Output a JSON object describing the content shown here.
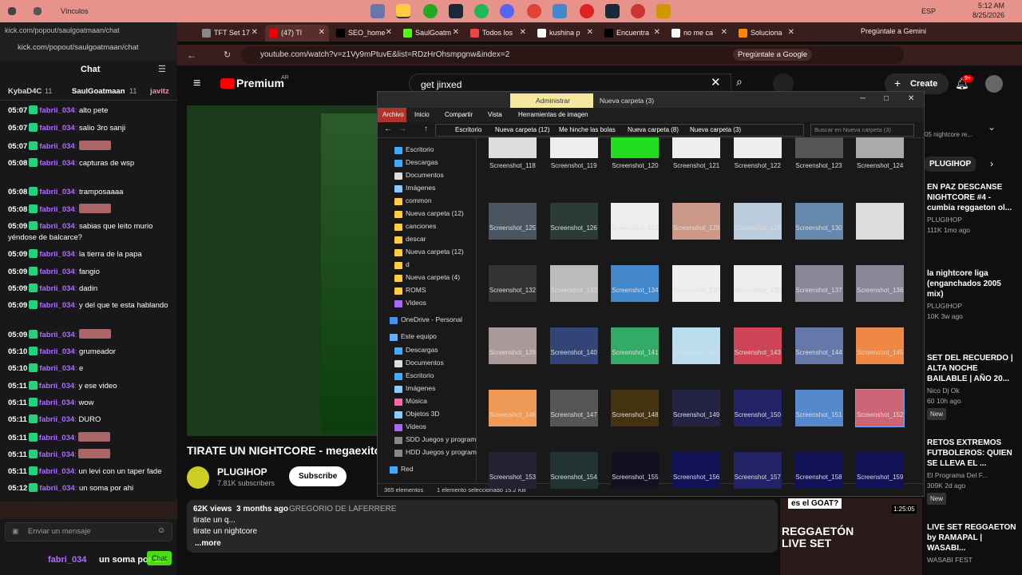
{
  "taskbar": {
    "vinculos": "Vínculos",
    "time": "5:12 AM",
    "date": "8/25/2026",
    "lang": "ESP"
  },
  "tabs": [
    {
      "label": "TFT Set 17",
      "color": "#888"
    },
    {
      "label": "(47) Tl",
      "color": "#e00"
    },
    {
      "label": "SEO_home",
      "color": "#000"
    },
    {
      "label": "SaulGoatm",
      "color": "#53fc18"
    },
    {
      "label": "Todos los",
      "color": "#e44"
    },
    {
      "label": "kushina p",
      "color": "#fff"
    },
    {
      "label": "Encuentra",
      "color": "#000"
    },
    {
      "label": "no me ca",
      "color": "#fff"
    },
    {
      "label": "Soluciona",
      "color": "#f80"
    }
  ],
  "kick": {
    "url": "kick.com/popout/saulgoatmaan/chat",
    "tab_title": "kick.com/popout/saulgoatmaan/chat",
    "chat_title": "Chat",
    "top_users": [
      "KybaD4C",
      "11",
      "SaulGoatmaan",
      "11",
      "javitz"
    ],
    "input_placeholder": "Enviar un mensaje",
    "send_label": "Chat",
    "bottom_user": "fabri_034",
    "bottom_text": "un soma por ahi"
  },
  "chat_messages": [
    {
      "time": "05:07",
      "user": "fabrii_034",
      "text": "alto pete"
    },
    {
      "time": "05:07",
      "user": "fabrii_034",
      "text": "salio 3ro sanji"
    },
    {
      "time": "05:07",
      "user": "fabrii_034",
      "text": ""
    },
    {
      "time": "05:08",
      "user": "fabrii_034",
      "text": "capturas de wsp"
    },
    {
      "time": "05:08",
      "user": "fabrii_034",
      "text": "tramposaaaa"
    },
    {
      "time": "05:08",
      "user": "fabrii_034",
      "text": ""
    },
    {
      "time": "05:09",
      "user": "fabrii_034",
      "text": "sabias que leito murio yéndose de balcarce?"
    },
    {
      "time": "05:09",
      "user": "fabrii_034",
      "text": "la tierra de la papa"
    },
    {
      "time": "05:09",
      "user": "fabrii_034",
      "text": "fangio"
    },
    {
      "time": "05:09",
      "user": "fabrii_034",
      "text": "dadin"
    },
    {
      "time": "05:09",
      "user": "fabrii_034",
      "text": "y del que te esta hablando"
    },
    {
      "time": "05:09",
      "user": "fabrii_034",
      "text": ""
    },
    {
      "time": "05:10",
      "user": "fabrii_034",
      "text": "grumeador"
    },
    {
      "time": "05:10",
      "user": "fabrii_034",
      "text": "e"
    },
    {
      "time": "05:11",
      "user": "fabrii_034",
      "text": "y ese video"
    },
    {
      "time": "05:11",
      "user": "fabrii_034",
      "text": "wow"
    },
    {
      "time": "05:11",
      "user": "fabrii_034",
      "text": "DURO"
    },
    {
      "time": "05:11",
      "user": "fabrii_034",
      "text": ""
    },
    {
      "time": "05:11",
      "user": "fabrii_034",
      "text": ""
    },
    {
      "time": "05:11",
      "user": "fabrii_034",
      "text": "un levi con un taper fade"
    },
    {
      "time": "05:12",
      "user": "fabrii_034",
      "text": "un soma por ahi"
    }
  ],
  "address": {
    "url": "youtube.com/watch?v=z1Vy9mPtuvE&list=RDzHrOhsmpgnw&index=2",
    "gemini": "Pregúntale a Google",
    "gemini_btn": "Pregúntale a Gemini"
  },
  "youtube": {
    "logo": "Premium",
    "region": "AR",
    "search": "get jinxed",
    "create": "Create",
    "notif": "9+",
    "video_title": "TIRATE UN NIGHTCORE - megaexito",
    "channel": "PLUGIHOP",
    "subs": "7.81K subscribers",
    "subscribe": "Subscribe",
    "views": "62K views",
    "ago": "3 months ago",
    "desc_tag": "GREGORIO DE LAFERRERE",
    "desc1": "tirate un q...",
    "desc2": "tirate un nightcore",
    "more": "...more",
    "chip": "PLUGIHOP",
    "panel_top": "05 nightcore re...",
    "thumb_text1": "es el GOAT?",
    "thumb_time": "1:25:05",
    "thumb_text2": "REGGAETÓN LIVE SET"
  },
  "recs": [
    {
      "title": "EN PAZ DESCANSE NIGHTCORE #4 - cumbia reggaeton ol...",
      "channel": "PLUGIHOP",
      "meta": "111K  1mo ago",
      "badge": ""
    },
    {
      "title": "la nightcore liga (enganchados 2005 mix)",
      "channel": "PLUGIHOP",
      "meta": "10K  3w ago",
      "badge": ""
    },
    {
      "title": "SET DEL RECUERDO | ALTA NOCHE BAILABLE | AÑO 20...",
      "channel": "Nico Dj Ok",
      "meta": "60  10h ago",
      "badge": "New"
    },
    {
      "title": "RETOS EXTREMOS FUTBOLEROS: QUIEN SE LLEVA EL ...",
      "channel": "El Programa Del F...",
      "meta": "309K  2d ago",
      "badge": "New"
    },
    {
      "title": "LIVE SET REGGAETON by RAMAPAL | WASABI...",
      "channel": "WASABI FEST",
      "meta": "",
      "badge": ""
    }
  ],
  "explorer": {
    "title_tab": "Administrar",
    "title": "Nueva carpeta (3)",
    "ribbon": [
      "Archivo",
      "Inicio",
      "Compartir",
      "Vista",
      "Herramientas de imagen"
    ],
    "breadcrumb": [
      "Escritorio",
      "Nueva carpeta (12)",
      "Me hinche las bolas",
      "Nueva carpeta (8)",
      "Nueva carpeta (3)"
    ],
    "search_placeholder": "Buscar en Nueva carpeta (3)",
    "status_count": "365 elementos",
    "status_sel": "1 elemento seleccionado  15.2 KB",
    "nav": [
      "Escritorio",
      "Descargas",
      "Documentos",
      "Imágenes",
      "common",
      "Nueva carpeta (12)",
      "canciones",
      "descar",
      "Nueva carpeta (12)",
      "d",
      "Nueva carpeta (4)",
      "ROMS",
      "Videos",
      "OneDrive - Personal",
      "Este equipo",
      "Descargas",
      "Documentos",
      "Escritorio",
      "Imágenes",
      "Música",
      "Objetos 3D",
      "Videos",
      "SDD Juegos y program",
      "HDD Juegos y program",
      "Red"
    ],
    "files": [
      "Screenshot_118",
      "Screenshot_119",
      "Screenshot_120",
      "Screenshot_121",
      "Screenshot_122",
      "Screenshot_123",
      "Screenshot_124",
      "Screenshot_125",
      "Screenshot_126",
      "Screenshot_127",
      "Screenshot_128",
      "Screenshot_129",
      "Screenshot_130",
      "Screenshot_131",
      "Screenshot_132",
      "Screenshot_133",
      "Screenshot_134",
      "Screenshot_135",
      "Screenshot_136",
      "Screenshot_137",
      "Screenshot_138",
      "Screenshot_139",
      "Screenshot_140",
      "Screenshot_141",
      "Screenshot_142",
      "Screenshot_143",
      "Screenshot_144",
      "Screenshot_145",
      "Screenshot_146",
      "Screenshot_147",
      "Screenshot_148",
      "Screenshot_149",
      "Screenshot_150",
      "Screenshot_151",
      "Screenshot_152",
      "Screenshot_153",
      "Screenshot_154",
      "Screenshot_155",
      "Screenshot_156",
      "Screenshot_157",
      "Screenshot_158",
      "Screenshot_159"
    ],
    "thumb_colors": [
      "#ddd",
      "#eee",
      "#22dd22",
      "#eee",
      "#eee",
      "#555",
      "#aaa",
      "#4a5560",
      "#2a3a35",
      "#eee",
      "#c98",
      "#bcd",
      "#68a",
      "#ddd",
      "#333",
      "#bbb",
      "#48c",
      "#eee",
      "#eee",
      "#889",
      "#889",
      "#a99",
      "#347",
      "#3a6",
      "#bde",
      "#c45",
      "#67a",
      "#e84",
      "#e95",
      "#555",
      "#431",
      "#224",
      "#226",
      "#58c",
      "#c67",
      "#223",
      "#233",
      "#112",
      "#115",
      "#226",
      "#115",
      "#115"
    ]
  }
}
